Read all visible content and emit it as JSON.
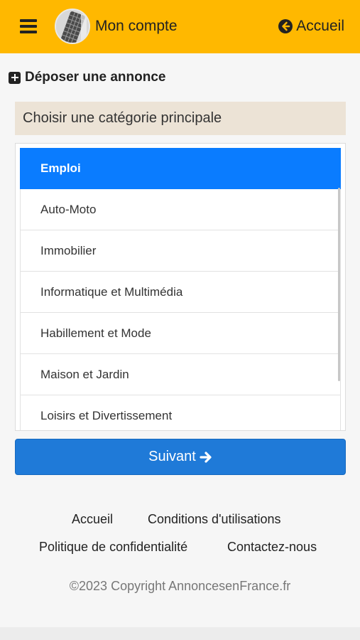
{
  "header": {
    "account_label": "Mon compte",
    "home_label": "Accueil",
    "background_color": "#ffb800",
    "icons": [
      "menu-icon",
      "avatar",
      "arrow-left-circle-icon"
    ]
  },
  "page": {
    "section_title": "Déposer une annonce",
    "category_prompt": "Choisir une catégorie principale"
  },
  "categories": [
    {
      "label": "Emploi",
      "selected": true
    },
    {
      "label": "Auto-Moto",
      "selected": false
    },
    {
      "label": "Immobilier",
      "selected": false
    },
    {
      "label": "Informatique et Multimédia",
      "selected": false
    },
    {
      "label": "Habillement et Mode",
      "selected": false
    },
    {
      "label": "Maison et Jardin",
      "selected": false
    },
    {
      "label": "Loisirs et Divertissement",
      "selected": false
    }
  ],
  "actions": {
    "next_label": "Suivant",
    "accent_color": "#1f7ad8"
  },
  "footer": {
    "links": [
      "Accueil",
      "Conditions d'utilisations",
      "Politique de confidentialité",
      "Contactez-nous"
    ],
    "copyright": "©2023 Copyright AnnoncesenFrance.fr"
  }
}
